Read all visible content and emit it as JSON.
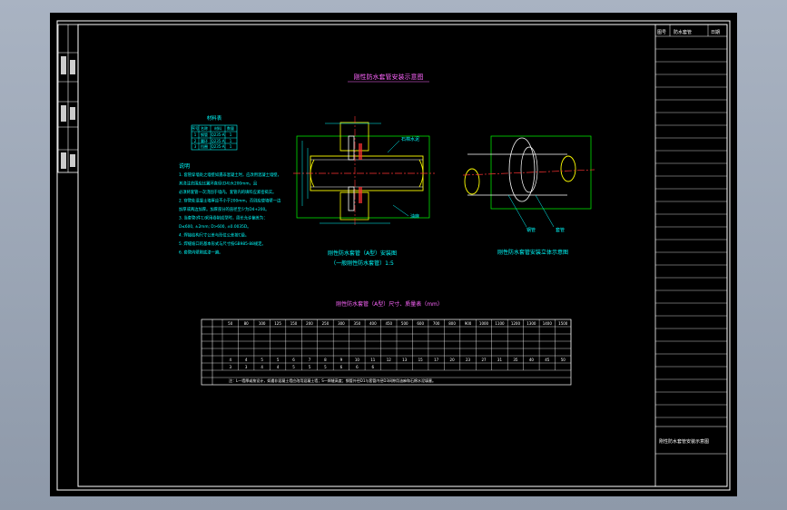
{
  "drawing": {
    "title": "刚性防水套管安装示意图",
    "materials_table": {
      "title": "材料表",
      "headers": [
        "序号",
        "名称",
        "材料",
        "数量"
      ],
      "rows": [
        [
          "1",
          "钢管",
          "Q235-A",
          "1"
        ],
        [
          "2",
          "翼环",
          "Q235-A",
          "1"
        ],
        [
          "3",
          "挡圈",
          "Q235-A",
          "1"
        ]
      ]
    },
    "notes_heading": "说明",
    "notes": [
      "1. 套管穿墙处之墙壁如遇非混凝土时，应改用混凝土墙壁，",
      "   其浇注范围应比翼环直径(D4)大200mm，且",
      "   必须将套管一次浇固于墙内。套管内的填料应紧密捣实。",
      "2. 穿管处混凝土墙厚应不小于200mm，否则应使墙壁一边",
      "   加厚或两边加厚。加厚部分的直径至少为D4+200。",
      "3. 当套管(件1)采用卷制成型时，周长允许偏差为：",
      "   D≤600, ±2mm; D>600, ±0.0035D。",
      "4. 焊接结构尺寸公差与形位公差按C级。",
      "5. 焊缝坡口的基本形式与尺寸按GB985-88规定。",
      "6. 套管内壁刷底漆一遍。"
    ],
    "section_caption": "刚性防水套管（A型）安装图",
    "section_subcaption": "（一般刚性防水套管）1:5",
    "view3d_caption": "刚性防水套管安装立体示意图",
    "callouts": [
      "石棉水泥",
      "油麻",
      "钢管",
      "套管",
      "挡圈"
    ],
    "dims_table": {
      "title": "刚性防水套管（A型）尺寸、质量表（mm）",
      "columns": [
        "50",
        "80",
        "100",
        "125",
        "150",
        "200",
        "250",
        "300",
        "350",
        "400",
        "450",
        "500",
        "600",
        "700",
        "800",
        "900",
        "1000",
        "1100",
        "1200",
        "1300",
        "1400",
        "1500"
      ],
      "weights": [
        "4",
        "4",
        "5",
        "5",
        "6",
        "7",
        "8",
        "9",
        "10",
        "11",
        "12",
        "13",
        "15",
        "17",
        "20",
        "23",
        "27",
        "31",
        "35",
        "40",
        "45",
        "50"
      ],
      "weights2": [
        "3",
        "3",
        "4",
        "4",
        "5",
        "5",
        "5",
        "6",
        "6",
        "6"
      ],
      "footnote": "注：L—墙厚或按设计，如遇非混凝土墙应改用混凝土墙；S—焊缝高度；钢管外径D1与套管内径D3间隙用油麻和石棉水泥填塞。"
    }
  },
  "title_block": {
    "header_cells": [
      "图号",
      "防水套管",
      "日期"
    ],
    "drawing_name": "刚性防水套管安装示意图"
  }
}
